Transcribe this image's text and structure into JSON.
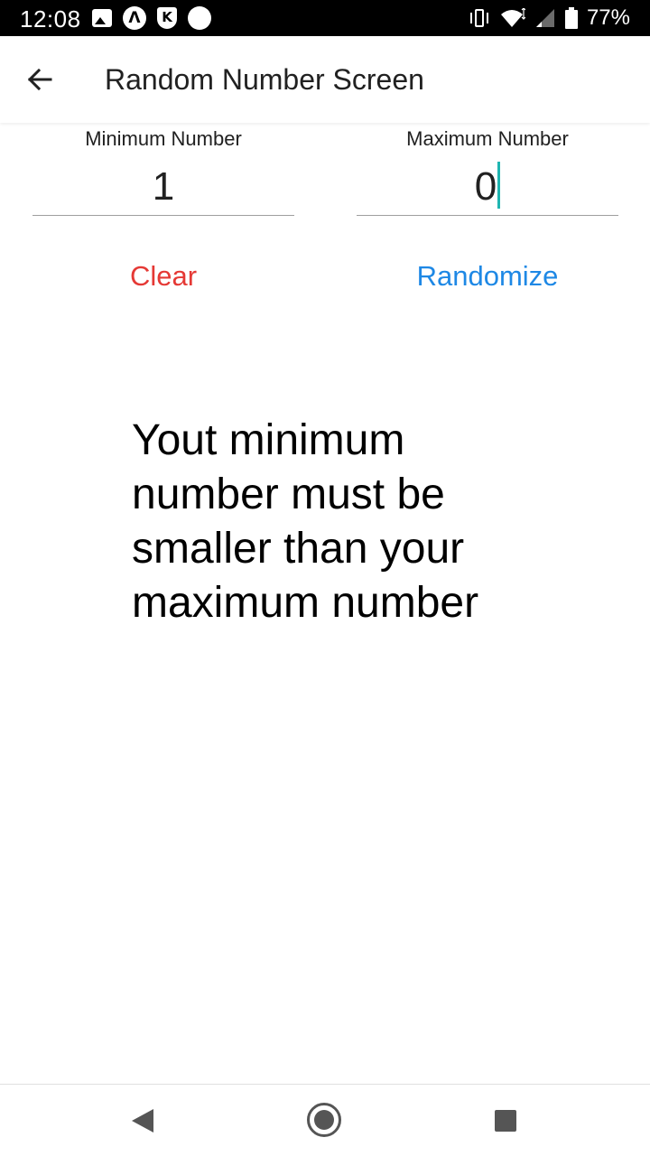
{
  "status_bar": {
    "time": "12:08",
    "battery_percent": "77%",
    "left_icons": [
      "image-icon",
      "a-circle-icon",
      "k-shield-icon",
      "dot-icon"
    ],
    "right_icons": [
      "vibrate-icon",
      "wifi-icon",
      "signal-icon",
      "battery-icon"
    ]
  },
  "app_bar": {
    "title": "Random Number Screen",
    "back_icon": "arrow-left-icon"
  },
  "fields": {
    "minimum": {
      "label": "Minimum Number",
      "value": "1"
    },
    "maximum": {
      "label": "Maximum Number",
      "value": "0"
    }
  },
  "buttons": {
    "clear": "Clear",
    "randomize": "Randomize"
  },
  "message": "Yout minimum number must be smaller than your maximum number",
  "colors": {
    "clear": "#e53935",
    "randomize": "#1e88e5",
    "cursor": "#1fb5b1"
  },
  "nav_bar": {
    "icons": [
      "back-triangle-icon",
      "home-circle-icon",
      "recents-square-icon"
    ]
  }
}
